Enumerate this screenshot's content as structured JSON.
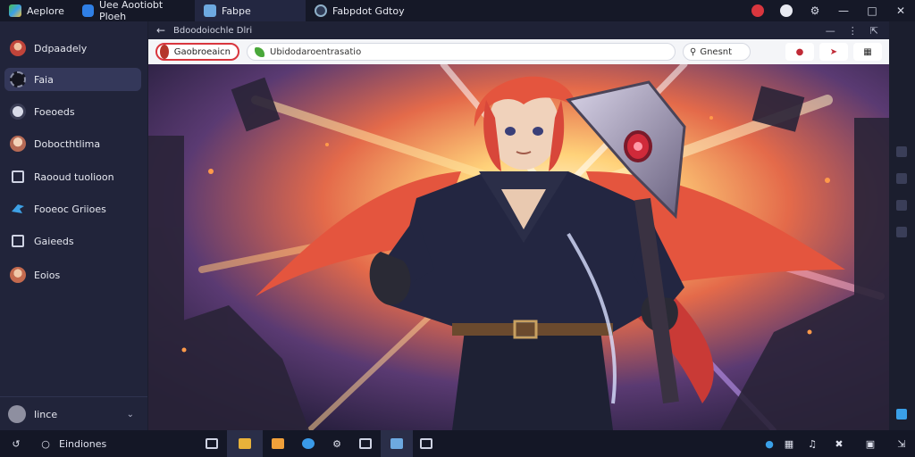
{
  "tabs": [
    {
      "label": "Aeplore",
      "icon": "app-stack-icon",
      "color": "#3aa0e8"
    },
    {
      "label": "Uee Aootiobt Ploeh",
      "icon": "store-bag-icon",
      "color": "#2f7fe6"
    },
    {
      "label": "Fabpe",
      "icon": "game-thumb-icon",
      "color": "#6da9e0"
    },
    {
      "label": "Fabpdot Gdtoy",
      "icon": "compass-icon",
      "color": "#2e3a55"
    }
  ],
  "sidebar": {
    "items": [
      {
        "label": "Ddpaadely",
        "icon": "avatar-icon",
        "color": "#c0443a"
      },
      {
        "label": "Faia",
        "icon": "gear-icon",
        "color": "#2b2e44"
      },
      {
        "label": "Foeoeds",
        "icon": "power-icon",
        "color": "#d8dbe8"
      },
      {
        "label": "Dobocthtlima",
        "icon": "avatar-icon",
        "color": "#b66a55"
      },
      {
        "label": "Raooud tuolioon",
        "icon": "window-icon",
        "color": "#cfd3e3"
      },
      {
        "label": "Fooeoc Griioes",
        "icon": "bird-icon",
        "color": "#3ea1e6"
      },
      {
        "label": "Gaieeds",
        "icon": "window-icon",
        "color": "#cfd3e3"
      },
      {
        "label": "Eoios",
        "icon": "avatar-icon",
        "color": "#c46a4e"
      }
    ],
    "user": {
      "label": "Iince"
    }
  },
  "browser": {
    "title": "Bdoodoiochle Dlri",
    "profile_label": "Gaobroeaicn",
    "address": "Ubidodaroentrasatio",
    "search_label": "Gnesnt"
  },
  "taskbar": {
    "label": "Eindiones"
  },
  "accent": "#d9363e"
}
